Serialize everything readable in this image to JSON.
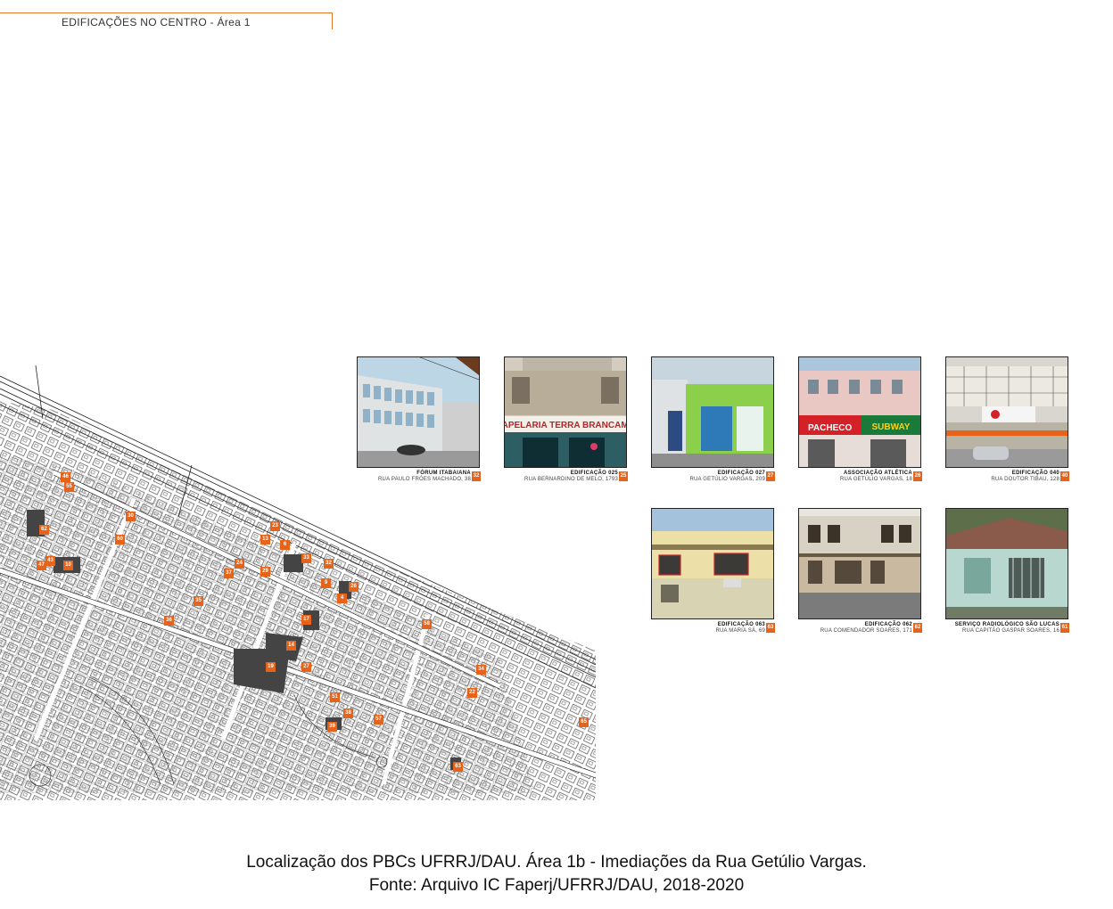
{
  "header": {
    "title": "EDIFICAÇÕES NO CENTRO - Área 1"
  },
  "map": {
    "markers": [
      "46",
      "55",
      "30",
      "62",
      "60",
      "47",
      "43",
      "10",
      "36",
      "13",
      "6",
      "23",
      "33",
      "24",
      "37",
      "29",
      "32",
      "4",
      "26",
      "9",
      "17",
      "35",
      "58",
      "14",
      "19",
      "27",
      "34",
      "22",
      "51",
      "38",
      "39",
      "57",
      "65",
      "63"
    ]
  },
  "cards": [
    {
      "title": "FÓRUM ITABAIANA",
      "address": "RUA PAULO FRÓES MACHADO, 38",
      "number": "32"
    },
    {
      "title": "EDIFICAÇÃO 025",
      "address": "RUA BERNARDINO DE MELO, 1793",
      "number": "25"
    },
    {
      "title": "EDIFICAÇÃO 027",
      "address": "RUA GETÚLIO VARGAS, 209",
      "number": "27"
    },
    {
      "title": "ASSOCIAÇÃO ATLÉTICA",
      "address": "RUA GETÚLIO VARGAS, 18",
      "number": "26"
    },
    {
      "title": "EDIFICAÇÃO 040",
      "address": "RUA DOUTOR TIBAU, 128",
      "number": "40"
    },
    {
      "title": "EDIFICAÇÃO 063",
      "address": "RUA MARIA SÁ, 69",
      "number": "63"
    },
    {
      "title": "EDIFICAÇÃO 062",
      "address": "RUA COMENDADOR SOARES, 171",
      "number": "62"
    },
    {
      "title": "SERVIÇO RADIOLÓGICO SÃO LUCAS",
      "address": "RUA CAPITÃO GASPAR SOARES, 16",
      "number": "61"
    }
  ],
  "photo_signs": {
    "papelaria": "PAPELARIA TERRA BRANCAME",
    "subway": "SUBWAY",
    "pacheco": "PACHECO"
  },
  "caption": {
    "line1": "Localização dos PBCs UFRRJ/DAU. Área 1b - Imediações da Rua Getúlio Vargas.",
    "line2": "Fonte: Arquivo IC Faperj/UFRRJ/DAU, 2018-2020"
  },
  "colors": {
    "accent": "#e8631a",
    "header_rule": "#e07a2a"
  }
}
